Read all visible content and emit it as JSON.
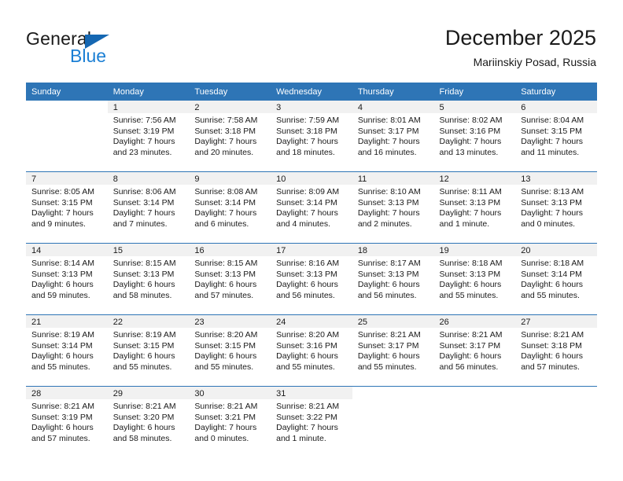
{
  "brand": {
    "name_top": "General",
    "name_bottom": "Blue",
    "triangle_color": "#1567b2",
    "blue_text_color": "#1b7fd4"
  },
  "header": {
    "title": "December 2025",
    "subtitle": "Mariinskiy Posad, Russia",
    "accent_color": "#2e75b6"
  },
  "weekdays": [
    "Sunday",
    "Monday",
    "Tuesday",
    "Wednesday",
    "Thursday",
    "Friday",
    "Saturday"
  ],
  "weeks": [
    [
      {
        "day": "",
        "sunrise": "",
        "sunset": "",
        "daylight_line1": "",
        "daylight_line2": "",
        "blank": true
      },
      {
        "day": "1",
        "sunrise": "Sunrise: 7:56 AM",
        "sunset": "Sunset: 3:19 PM",
        "daylight_line1": "Daylight: 7 hours",
        "daylight_line2": "and 23 minutes."
      },
      {
        "day": "2",
        "sunrise": "Sunrise: 7:58 AM",
        "sunset": "Sunset: 3:18 PM",
        "daylight_line1": "Daylight: 7 hours",
        "daylight_line2": "and 20 minutes."
      },
      {
        "day": "3",
        "sunrise": "Sunrise: 7:59 AM",
        "sunset": "Sunset: 3:18 PM",
        "daylight_line1": "Daylight: 7 hours",
        "daylight_line2": "and 18 minutes."
      },
      {
        "day": "4",
        "sunrise": "Sunrise: 8:01 AM",
        "sunset": "Sunset: 3:17 PM",
        "daylight_line1": "Daylight: 7 hours",
        "daylight_line2": "and 16 minutes."
      },
      {
        "day": "5",
        "sunrise": "Sunrise: 8:02 AM",
        "sunset": "Sunset: 3:16 PM",
        "daylight_line1": "Daylight: 7 hours",
        "daylight_line2": "and 13 minutes."
      },
      {
        "day": "6",
        "sunrise": "Sunrise: 8:04 AM",
        "sunset": "Sunset: 3:15 PM",
        "daylight_line1": "Daylight: 7 hours",
        "daylight_line2": "and 11 minutes."
      }
    ],
    [
      {
        "day": "7",
        "sunrise": "Sunrise: 8:05 AM",
        "sunset": "Sunset: 3:15 PM",
        "daylight_line1": "Daylight: 7 hours",
        "daylight_line2": "and 9 minutes."
      },
      {
        "day": "8",
        "sunrise": "Sunrise: 8:06 AM",
        "sunset": "Sunset: 3:14 PM",
        "daylight_line1": "Daylight: 7 hours",
        "daylight_line2": "and 7 minutes."
      },
      {
        "day": "9",
        "sunrise": "Sunrise: 8:08 AM",
        "sunset": "Sunset: 3:14 PM",
        "daylight_line1": "Daylight: 7 hours",
        "daylight_line2": "and 6 minutes."
      },
      {
        "day": "10",
        "sunrise": "Sunrise: 8:09 AM",
        "sunset": "Sunset: 3:14 PM",
        "daylight_line1": "Daylight: 7 hours",
        "daylight_line2": "and 4 minutes."
      },
      {
        "day": "11",
        "sunrise": "Sunrise: 8:10 AM",
        "sunset": "Sunset: 3:13 PM",
        "daylight_line1": "Daylight: 7 hours",
        "daylight_line2": "and 2 minutes."
      },
      {
        "day": "12",
        "sunrise": "Sunrise: 8:11 AM",
        "sunset": "Sunset: 3:13 PM",
        "daylight_line1": "Daylight: 7 hours",
        "daylight_line2": "and 1 minute."
      },
      {
        "day": "13",
        "sunrise": "Sunrise: 8:13 AM",
        "sunset": "Sunset: 3:13 PM",
        "daylight_line1": "Daylight: 7 hours",
        "daylight_line2": "and 0 minutes."
      }
    ],
    [
      {
        "day": "14",
        "sunrise": "Sunrise: 8:14 AM",
        "sunset": "Sunset: 3:13 PM",
        "daylight_line1": "Daylight: 6 hours",
        "daylight_line2": "and 59 minutes."
      },
      {
        "day": "15",
        "sunrise": "Sunrise: 8:15 AM",
        "sunset": "Sunset: 3:13 PM",
        "daylight_line1": "Daylight: 6 hours",
        "daylight_line2": "and 58 minutes."
      },
      {
        "day": "16",
        "sunrise": "Sunrise: 8:15 AM",
        "sunset": "Sunset: 3:13 PM",
        "daylight_line1": "Daylight: 6 hours",
        "daylight_line2": "and 57 minutes."
      },
      {
        "day": "17",
        "sunrise": "Sunrise: 8:16 AM",
        "sunset": "Sunset: 3:13 PM",
        "daylight_line1": "Daylight: 6 hours",
        "daylight_line2": "and 56 minutes."
      },
      {
        "day": "18",
        "sunrise": "Sunrise: 8:17 AM",
        "sunset": "Sunset: 3:13 PM",
        "daylight_line1": "Daylight: 6 hours",
        "daylight_line2": "and 56 minutes."
      },
      {
        "day": "19",
        "sunrise": "Sunrise: 8:18 AM",
        "sunset": "Sunset: 3:13 PM",
        "daylight_line1": "Daylight: 6 hours",
        "daylight_line2": "and 55 minutes."
      },
      {
        "day": "20",
        "sunrise": "Sunrise: 8:18 AM",
        "sunset": "Sunset: 3:14 PM",
        "daylight_line1": "Daylight: 6 hours",
        "daylight_line2": "and 55 minutes."
      }
    ],
    [
      {
        "day": "21",
        "sunrise": "Sunrise: 8:19 AM",
        "sunset": "Sunset: 3:14 PM",
        "daylight_line1": "Daylight: 6 hours",
        "daylight_line2": "and 55 minutes."
      },
      {
        "day": "22",
        "sunrise": "Sunrise: 8:19 AM",
        "sunset": "Sunset: 3:15 PM",
        "daylight_line1": "Daylight: 6 hours",
        "daylight_line2": "and 55 minutes."
      },
      {
        "day": "23",
        "sunrise": "Sunrise: 8:20 AM",
        "sunset": "Sunset: 3:15 PM",
        "daylight_line1": "Daylight: 6 hours",
        "daylight_line2": "and 55 minutes."
      },
      {
        "day": "24",
        "sunrise": "Sunrise: 8:20 AM",
        "sunset": "Sunset: 3:16 PM",
        "daylight_line1": "Daylight: 6 hours",
        "daylight_line2": "and 55 minutes."
      },
      {
        "day": "25",
        "sunrise": "Sunrise: 8:21 AM",
        "sunset": "Sunset: 3:17 PM",
        "daylight_line1": "Daylight: 6 hours",
        "daylight_line2": "and 55 minutes."
      },
      {
        "day": "26",
        "sunrise": "Sunrise: 8:21 AM",
        "sunset": "Sunset: 3:17 PM",
        "daylight_line1": "Daylight: 6 hours",
        "daylight_line2": "and 56 minutes."
      },
      {
        "day": "27",
        "sunrise": "Sunrise: 8:21 AM",
        "sunset": "Sunset: 3:18 PM",
        "daylight_line1": "Daylight: 6 hours",
        "daylight_line2": "and 57 minutes."
      }
    ],
    [
      {
        "day": "28",
        "sunrise": "Sunrise: 8:21 AM",
        "sunset": "Sunset: 3:19 PM",
        "daylight_line1": "Daylight: 6 hours",
        "daylight_line2": "and 57 minutes."
      },
      {
        "day": "29",
        "sunrise": "Sunrise: 8:21 AM",
        "sunset": "Sunset: 3:20 PM",
        "daylight_line1": "Daylight: 6 hours",
        "daylight_line2": "and 58 minutes."
      },
      {
        "day": "30",
        "sunrise": "Sunrise: 8:21 AM",
        "sunset": "Sunset: 3:21 PM",
        "daylight_line1": "Daylight: 7 hours",
        "daylight_line2": "and 0 minutes."
      },
      {
        "day": "31",
        "sunrise": "Sunrise: 8:21 AM",
        "sunset": "Sunset: 3:22 PM",
        "daylight_line1": "Daylight: 7 hours",
        "daylight_line2": "and 1 minute."
      },
      {
        "day": "",
        "sunrise": "",
        "sunset": "",
        "daylight_line1": "",
        "daylight_line2": "",
        "blank": true
      },
      {
        "day": "",
        "sunrise": "",
        "sunset": "",
        "daylight_line1": "",
        "daylight_line2": "",
        "blank": true
      },
      {
        "day": "",
        "sunrise": "",
        "sunset": "",
        "daylight_line1": "",
        "daylight_line2": "",
        "blank": true
      }
    ]
  ]
}
